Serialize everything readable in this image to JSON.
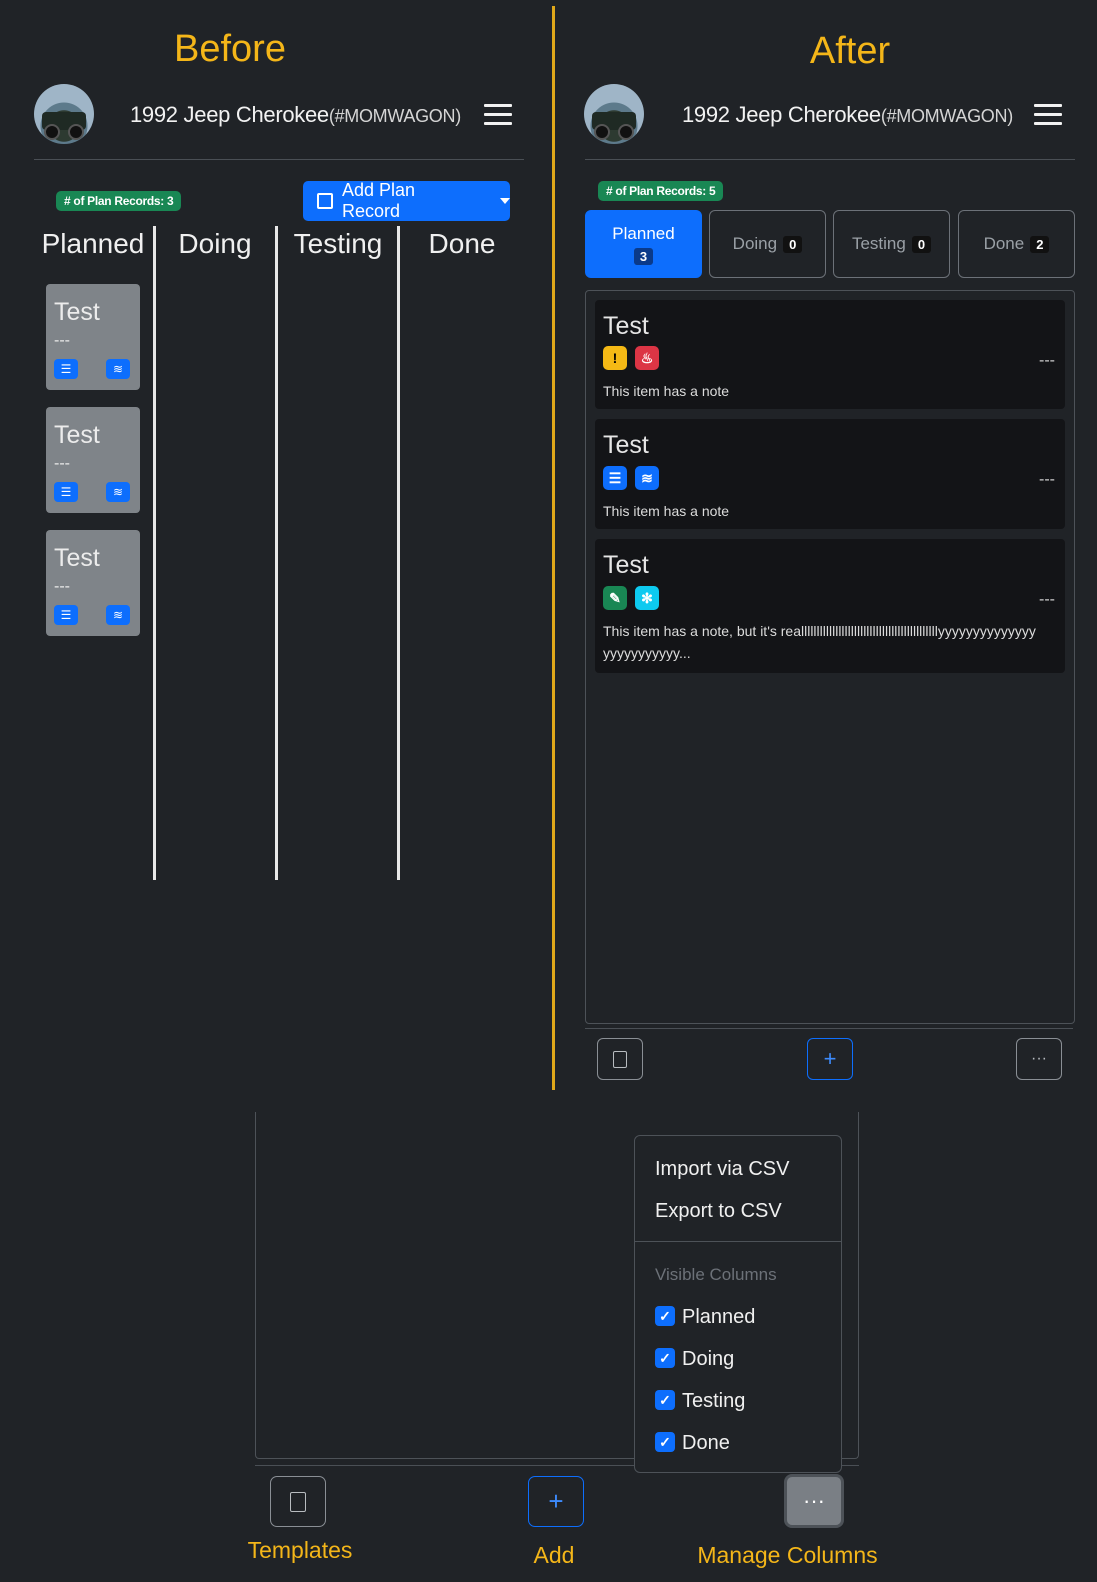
{
  "before": {
    "heading": "Before",
    "vehicle_title": "1992 Jeep Cherokee",
    "vehicle_tag": "(#MOMWAGON)",
    "records_badge": "# of Plan Records: 3",
    "add_button": "Add Plan Record",
    "columns": [
      "Planned",
      "Doing",
      "Testing",
      "Done"
    ],
    "cards": [
      {
        "title": "Test",
        "desc": "---"
      },
      {
        "title": "Test",
        "desc": "---"
      },
      {
        "title": "Test",
        "desc": "---"
      }
    ]
  },
  "after": {
    "heading": "After",
    "vehicle_title": "1992 Jeep Cherokee",
    "vehicle_tag": "(#MOMWAGON)",
    "records_badge": "# of Plan Records: 5",
    "tabs": [
      {
        "label": "Planned",
        "count": "3"
      },
      {
        "label": "Doing",
        "count": "0"
      },
      {
        "label": "Testing",
        "count": "0"
      },
      {
        "label": "Done",
        "count": "2"
      }
    ],
    "cards": [
      {
        "title": "Test",
        "dash": "---",
        "note": "This item has a note",
        "icons": [
          "exclamation-icon",
          "fire-icon"
        ]
      },
      {
        "title": "Test",
        "dash": "---",
        "note": "This item has a note",
        "icons": [
          "card-icon",
          "water-icon"
        ]
      },
      {
        "title": "Test",
        "dash": "---",
        "note": "This item has a note, but it's reallllllllllllllllllllllllllllllllllllllllllllyyyyyyyyyyyyyy",
        "note2": "yyyyyyyyyyy...",
        "icons": [
          "wrench-icon",
          "snowflake-icon"
        ]
      }
    ]
  },
  "menu": {
    "import": "Import via CSV",
    "export": "Export to CSV",
    "header": "Visible Columns",
    "columns": [
      "Planned",
      "Doing",
      "Testing",
      "Done"
    ]
  },
  "captions": {
    "templates": "Templates",
    "add": "Add",
    "manage": "Manage Columns"
  },
  "colors": {
    "accent": "#f4b619",
    "primary": "#0d6efd",
    "success": "#198754",
    "background": "#202327"
  }
}
